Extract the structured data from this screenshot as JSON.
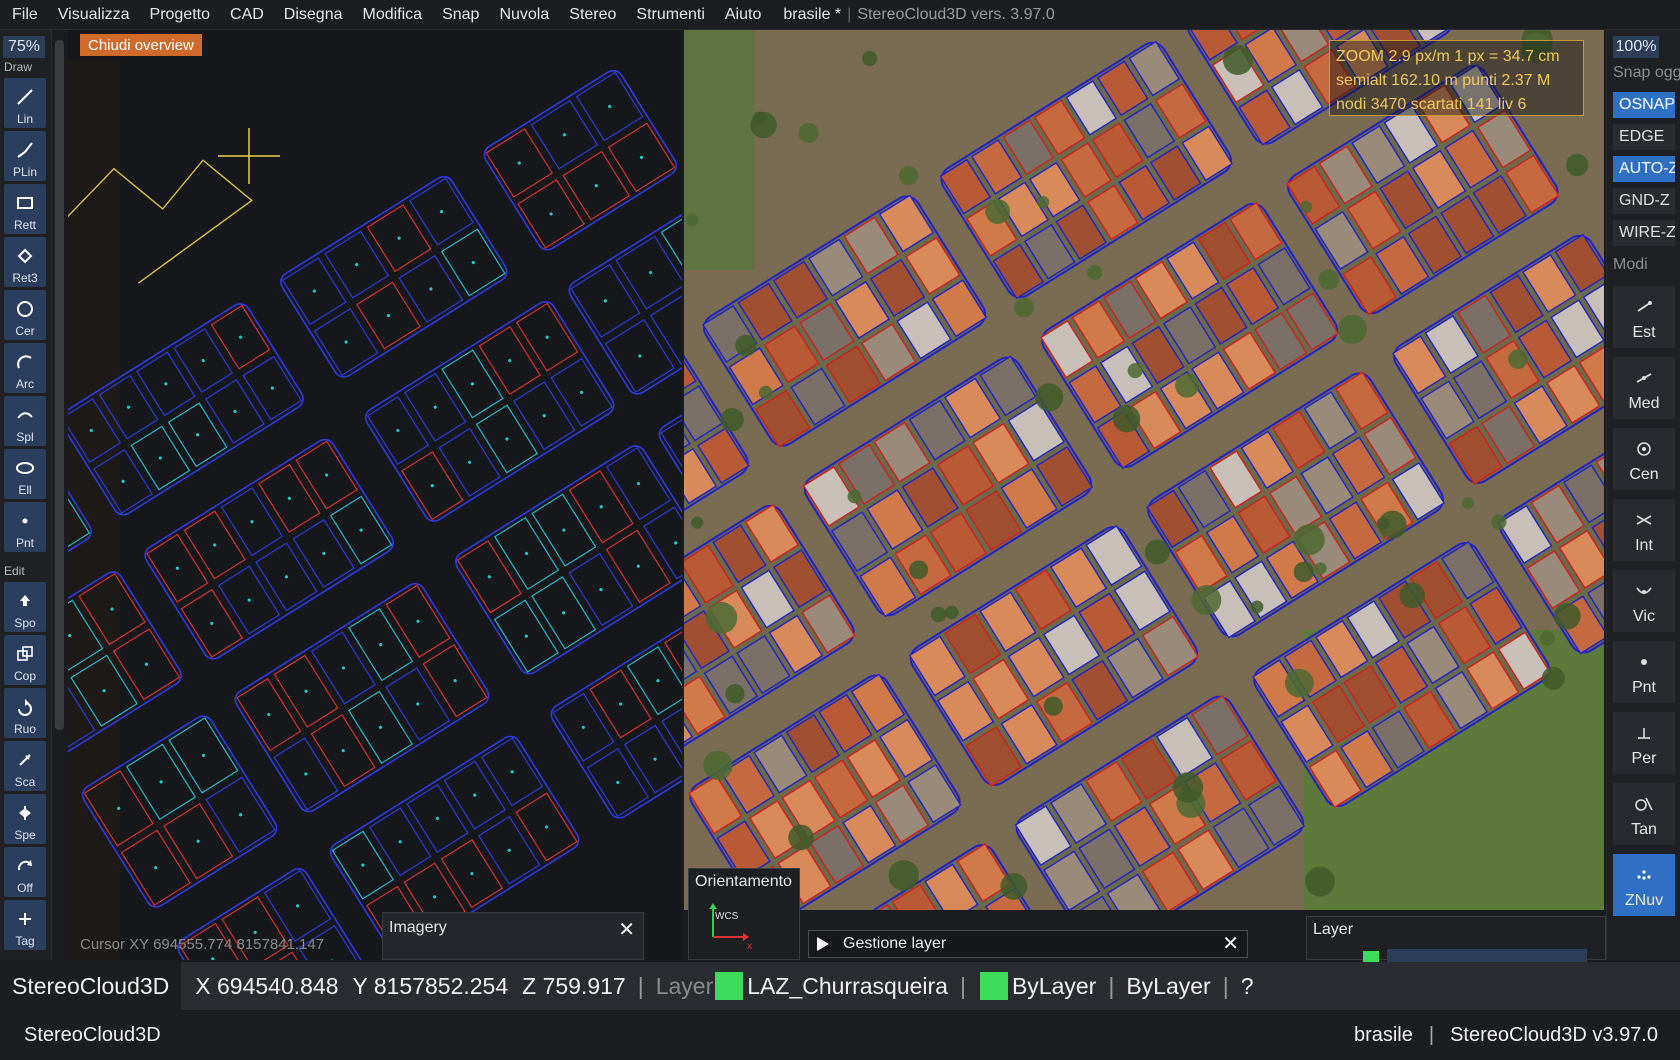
{
  "menubar": {
    "items": [
      "File",
      "Visualizza",
      "Progetto",
      "CAD",
      "Disegna",
      "Modifica",
      "Snap",
      "Nuvola",
      "Stereo",
      "Strumenti",
      "Aiuto"
    ],
    "document": "brasile *",
    "separator": "|",
    "app_version": "StereoCloud3D vers. 3.97.0"
  },
  "left_toolbar": {
    "zoom": "75%",
    "draw_label": "Draw",
    "draw_tools": [
      {
        "label": "Lin",
        "icon": "line-icon"
      },
      {
        "label": "PLin",
        "icon": "polyline-icon"
      },
      {
        "label": "Rett",
        "icon": "rectangle-icon"
      },
      {
        "label": "Ret3",
        "icon": "rectangle-3pt-icon"
      },
      {
        "label": "Cer",
        "icon": "circle-icon"
      },
      {
        "label": "Arc",
        "icon": "arc-icon"
      },
      {
        "label": "Spl",
        "icon": "spline-icon"
      },
      {
        "label": "Ell",
        "icon": "ellipse-icon"
      },
      {
        "label": "Pnt",
        "icon": "point-icon"
      }
    ],
    "edit_label": "Edit",
    "edit_tools": [
      {
        "label": "Spo",
        "icon": "move-icon"
      },
      {
        "label": "Cop",
        "icon": "copy-icon"
      },
      {
        "label": "Ruo",
        "icon": "rotate-icon"
      },
      {
        "label": "Sca",
        "icon": "scale-icon"
      },
      {
        "label": "Spe",
        "icon": "mirror-icon"
      },
      {
        "label": "Off",
        "icon": "offset-icon"
      },
      {
        "label": "Tag",
        "icon": "trim-icon"
      }
    ]
  },
  "overview": {
    "close_label": "Chiudi overview",
    "cursor_readout": "Cursor XY  694555.774  8157841.147"
  },
  "imagery_panel": {
    "title": "Imagery",
    "close": "✕"
  },
  "mainview": {
    "info": {
      "line1": "ZOOM  2.9 px/m    1 px = 34.7 cm",
      "line2": "semialt  162.10 m        punti 2.37 M",
      "line3": "nodi 3470  scartati 141  liv 6"
    },
    "colors": {
      "road": "#a88a6a",
      "roof": "#c56a40",
      "vector_blue": "#2323c8",
      "vector_red": "#d02020",
      "grass": "#5d7a3a"
    }
  },
  "orientation": {
    "title": "Orientamento",
    "axis_label": "WCS",
    "x_label": "x"
  },
  "gestione_layer": {
    "title": "Gestione layer",
    "close": "✕"
  },
  "layer_panel": {
    "title": "Layer"
  },
  "right_toolbar": {
    "zoom": "100%",
    "snap_label": "Snap ogg",
    "snap_toggles": [
      {
        "label": "OSNAP",
        "on": true
      },
      {
        "label": "EDGE",
        "on": false
      },
      {
        "label": "AUTO-Z",
        "on": true
      },
      {
        "label": "GND-Z",
        "on": false
      },
      {
        "label": "WIRE-Z",
        "on": false
      }
    ],
    "modi_label": "Modi",
    "modes": [
      {
        "label": "Est",
        "icon": "endpoint-icon"
      },
      {
        "label": "Med",
        "icon": "midpoint-icon"
      },
      {
        "label": "Cen",
        "icon": "center-icon"
      },
      {
        "label": "Int",
        "icon": "intersection-icon"
      },
      {
        "label": "Vic",
        "icon": "nearest-icon"
      },
      {
        "label": "Pnt",
        "icon": "node-icon"
      },
      {
        "label": "Per",
        "icon": "perpendicular-icon"
      },
      {
        "label": "Tan",
        "icon": "tangent-icon"
      },
      {
        "label": "ZNuv",
        "icon": "cloud-z-icon",
        "active": true
      }
    ]
  },
  "statusbar": {
    "app": "StereoCloud3D",
    "x": "X 694540.848",
    "y": "Y 8157852.254",
    "z": "Z 759.917",
    "sep": "|",
    "layer_label": "Layer",
    "layer_name": "LAZ_Churrasqueira",
    "color_value": "ByLayer",
    "linetype_value": "ByLayer",
    "help": "?",
    "swatch_color": "#3ddc5a"
  },
  "footer": {
    "left": "StereoCloud3D",
    "project": "brasile",
    "sep": "|",
    "version": "StereoCloud3D v3.97.0"
  }
}
